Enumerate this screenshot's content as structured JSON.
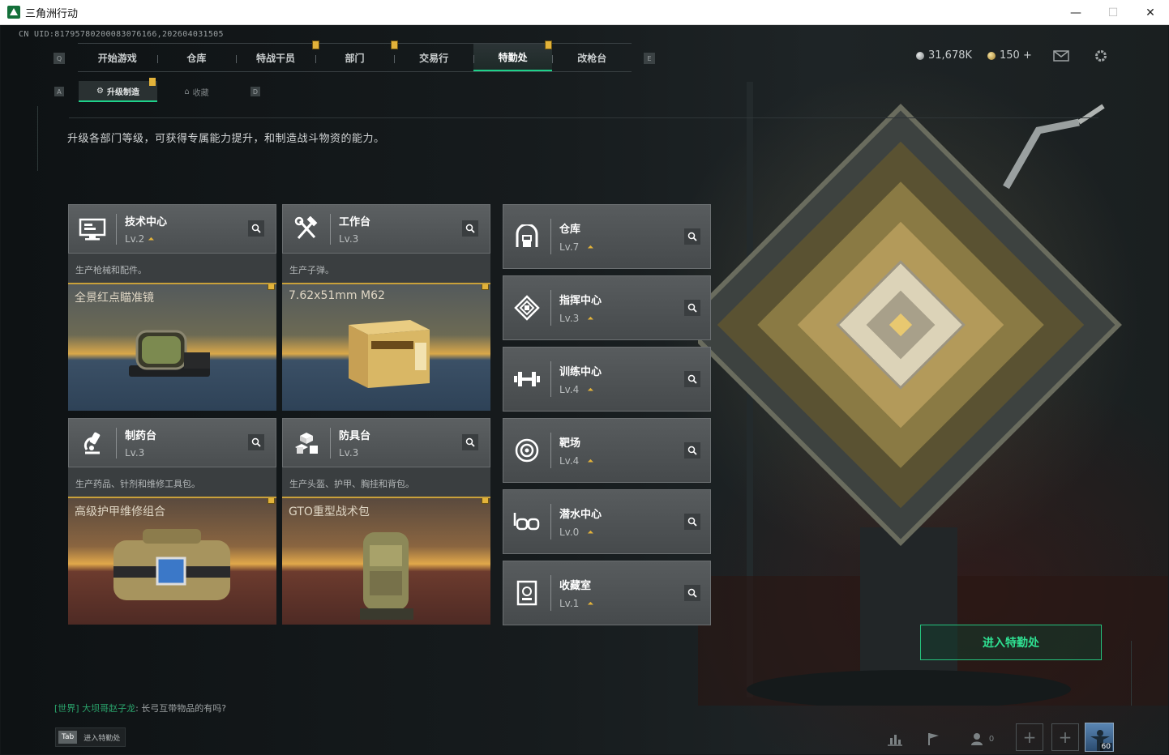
{
  "window": {
    "title": "三角洲行动",
    "minimize": "—",
    "maximize": "☐",
    "close": "✕"
  },
  "uid": "CN UID:817957802000830761​66,202604031505",
  "nav": {
    "left_key": "Q",
    "right_key": "E",
    "tabs": [
      {
        "label": "开始游戏",
        "dot": false
      },
      {
        "label": "仓库",
        "dot": false
      },
      {
        "label": "特战干员",
        "dot": true
      },
      {
        "label": "部门",
        "dot": true
      },
      {
        "label": "交易行",
        "dot": false
      },
      {
        "label": "特勤处",
        "dot": true,
        "active": true
      },
      {
        "label": "改枪台",
        "dot": false
      }
    ]
  },
  "currency": {
    "silver": "31,678K",
    "gold": "150 +"
  },
  "subnav": {
    "left_key": "A",
    "right_key": "D",
    "tabs": [
      {
        "label": "升级制造",
        "active": true
      },
      {
        "label": "收藏",
        "active": false
      }
    ]
  },
  "description": "升级各部门等级，可获得专属能力提升，和制造战斗物资的能力。",
  "production_cards": [
    {
      "name": "技术中心",
      "level": "Lv.2",
      "icon": "monitor-icon",
      "desc": "生产枪械和配件。",
      "item": "全景红点瞄准镜",
      "theme": "blue"
    },
    {
      "name": "工作台",
      "level": "Lv.3",
      "icon": "hammer-wrench-icon",
      "desc": "生产子弹。",
      "item": "7.62x51mm M62",
      "theme": "blue"
    },
    {
      "name": "制药台",
      "level": "Lv.3",
      "icon": "microscope-icon",
      "desc": "生产药品、针剂和维修工具包。",
      "item": "高级护甲维修组合",
      "theme": "red"
    },
    {
      "name": "防具台",
      "level": "Lv.3",
      "icon": "cubes-icon",
      "desc": "生产头盔、护甲、胸挂和背包。",
      "item": "GTO重型战术包",
      "theme": "red"
    }
  ],
  "facility_cards": [
    {
      "name": "仓库",
      "level": "Lv.7",
      "icon": "warehouse-icon"
    },
    {
      "name": "指挥中心",
      "level": "Lv.3",
      "icon": "command-icon"
    },
    {
      "name": "训练中心",
      "level": "Lv.4",
      "icon": "dumbbell-icon"
    },
    {
      "name": "靶场",
      "level": "Lv.4",
      "icon": "target-icon"
    },
    {
      "name": "潜水中心",
      "level": "Lv.0",
      "icon": "goggles-icon"
    },
    {
      "name": "收藏室",
      "level": "Lv.1",
      "icon": "trophy-icon"
    }
  ],
  "enter_button": "进入特勤处",
  "chat": {
    "channel": "[世界]",
    "user": "大坝哥赵子龙",
    "message": ": 长弓互带物品的有吗?"
  },
  "tab_hint": {
    "key": "Tab",
    "label": "进入特勤处"
  },
  "social": {
    "friends_count": "0",
    "plus": "+"
  },
  "avatar_level": "60",
  "colors": {
    "accent": "#1ed18a",
    "gold": "#e3b33a"
  }
}
